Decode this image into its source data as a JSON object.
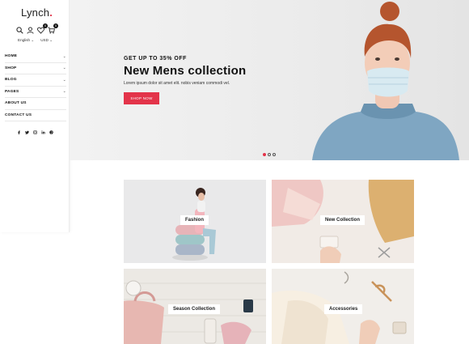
{
  "brand": {
    "name": "Lynch",
    "dot": ".",
    "accent": "#e3344a"
  },
  "header_icons": [
    {
      "name": "search-icon"
    },
    {
      "name": "user-icon"
    },
    {
      "name": "heart-icon",
      "badge": "0"
    },
    {
      "name": "cart-icon",
      "badge": "0"
    }
  ],
  "selectors": {
    "language": "English",
    "currency": "USD"
  },
  "menu": [
    {
      "label": "HOME",
      "has_submenu": true
    },
    {
      "label": "SHOP",
      "has_submenu": true
    },
    {
      "label": "BLOG",
      "has_submenu": true
    },
    {
      "label": "PAGES",
      "has_submenu": true
    },
    {
      "label": "ABOUT US",
      "has_submenu": false
    },
    {
      "label": "CONTACT US",
      "has_submenu": false
    }
  ],
  "social": [
    "facebook-icon",
    "twitter-icon",
    "instagram-icon",
    "linkedin-icon",
    "pinterest-icon"
  ],
  "hero": {
    "subtitle": "GET UP TO 35% OFF",
    "title": "New Mens collection",
    "description": "Lorem ipsum dolor sit amet elit. nobis veniam commodi vel.",
    "button": "SHOP NOW",
    "slides": 3,
    "active_slide": 1
  },
  "categories": [
    {
      "label": "Fashion"
    },
    {
      "label": "New Collection"
    },
    {
      "label": "Season Collection"
    },
    {
      "label": "Accessories"
    }
  ]
}
